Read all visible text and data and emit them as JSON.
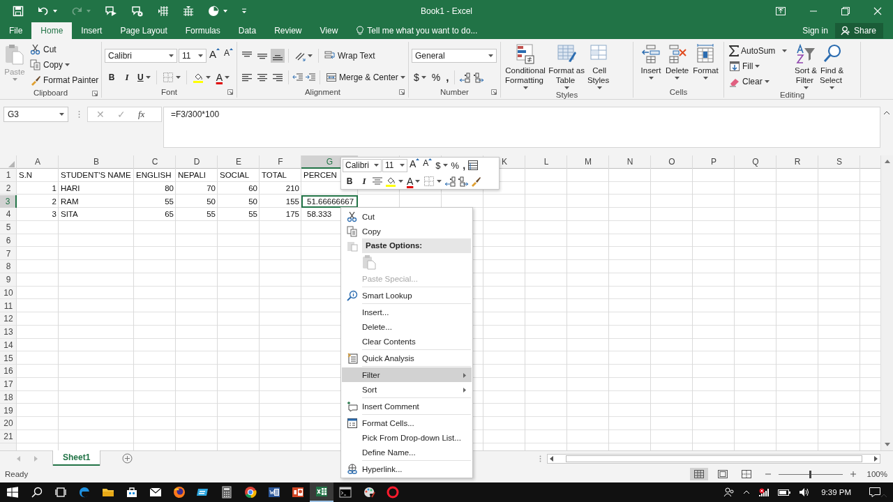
{
  "window": {
    "title": "Book1 - Excel"
  },
  "ribbon_tabs": [
    {
      "label": "File",
      "selected": false
    },
    {
      "label": "Home",
      "selected": true
    },
    {
      "label": "Insert",
      "selected": false
    },
    {
      "label": "Page Layout",
      "selected": false
    },
    {
      "label": "Formulas",
      "selected": false
    },
    {
      "label": "Data",
      "selected": false
    },
    {
      "label": "Review",
      "selected": false
    },
    {
      "label": "View",
      "selected": false
    }
  ],
  "tell_me": {
    "placeholder": "Tell me what you want to do..."
  },
  "account": {
    "sign_in": "Sign in",
    "share": "Share"
  },
  "ribbon": {
    "clipboard": {
      "label": "Clipboard",
      "paste": "Paste",
      "cut": "Cut",
      "copy": "Copy",
      "format_painter": "Format Painter"
    },
    "font": {
      "label": "Font",
      "font_name": "Calibri",
      "font_size": "11",
      "grow": "A",
      "shrink": "A",
      "bold": "B",
      "italic": "I",
      "underline": "U",
      "font_color": "A"
    },
    "alignment": {
      "label": "Alignment",
      "vertical_align": [
        {
          "selected": false
        },
        {
          "selected": false
        },
        {
          "selected": true
        }
      ],
      "wrap_text": "Wrap Text",
      "merge_center": "Merge & Center"
    },
    "number": {
      "label": "Number",
      "format": "General",
      "currency": "$",
      "percent": "%",
      "comma": ","
    },
    "styles": {
      "label": "Styles",
      "buttons": [
        "Conditional\nFormatting",
        "Format as\nTable",
        "Cell\nStyles"
      ]
    },
    "cells": {
      "label": "Cells",
      "buttons": [
        "Insert",
        "Delete",
        "Format"
      ]
    },
    "editing": {
      "label": "Editing",
      "autosum": "AutoSum",
      "fill": "Fill",
      "clear": "Clear",
      "sort_filter": "Sort &\nFilter",
      "find_select": "Find &\nSelect"
    }
  },
  "formula_bar": {
    "name_box": "G3",
    "cancel": "✕",
    "enter": "✓",
    "function": "fx",
    "formula": "=F3/300*100"
  },
  "sheet": {
    "columns": [
      {
        "label": "A",
        "selected": false,
        "kind": "number"
      },
      {
        "label": "B",
        "selected": false,
        "kind": "text"
      },
      {
        "label": "C",
        "selected": false,
        "kind": "number"
      },
      {
        "label": "D",
        "selected": false,
        "kind": "number"
      },
      {
        "label": "E",
        "selected": false,
        "kind": "number"
      },
      {
        "label": "F",
        "selected": false,
        "kind": "number"
      },
      {
        "label": "G",
        "selected": true,
        "kind": "decimal"
      },
      {
        "selected": false
      },
      {
        "selected": false
      },
      {
        "selected": false
      },
      {
        "label": "K",
        "selected": false
      },
      {
        "label": "L",
        "selected": false
      },
      {
        "label": "M",
        "selected": false
      },
      {
        "label": "N",
        "selected": false
      },
      {
        "label": "O",
        "selected": false
      },
      {
        "label": "P",
        "selected": false
      },
      {
        "label": "Q",
        "selected": false
      },
      {
        "label": "R",
        "selected": false
      },
      {
        "label": "S",
        "selected": false
      }
    ],
    "rows": [
      {
        "label": "1",
        "selected": false,
        "kind": "header",
        "cells": [
          "S.N",
          "STUDENT'S NAME",
          "ENGLISH",
          "NEPALI",
          "SOCIAL",
          "TOTAL",
          "PERCEN"
        ]
      },
      {
        "label": "2",
        "selected": false,
        "kind": "data",
        "cells": [
          "1",
          "HARI",
          "80",
          "70",
          "60",
          "210"
        ]
      },
      {
        "label": "3",
        "selected": true,
        "kind": "data",
        "cells": [
          "2",
          "RAM",
          "55",
          "50",
          "50",
          "155",
          "51.66666667"
        ]
      },
      {
        "label": "4",
        "selected": false,
        "kind": "data",
        "cells": [
          "3",
          "SITA",
          "65",
          "55",
          "55",
          "175",
          "58.333"
        ]
      },
      {
        "label": "5",
        "selected": false
      },
      {
        "label": "6",
        "selected": false
      },
      {
        "label": "7",
        "selected": false
      },
      {
        "label": "8",
        "selected": false
      },
      {
        "label": "9",
        "selected": false
      },
      {
        "label": "10",
        "selected": false
      },
      {
        "label": "11",
        "selected": false
      },
      {
        "label": "12",
        "selected": false
      },
      {
        "label": "13",
        "selected": false
      },
      {
        "label": "14",
        "selected": false
      },
      {
        "label": "15",
        "selected": false
      },
      {
        "label": "16",
        "selected": false
      },
      {
        "label": "17",
        "selected": false
      },
      {
        "label": "18",
        "selected": false
      },
      {
        "label": "19",
        "selected": false
      },
      {
        "label": "20",
        "selected": false
      },
      {
        "label": "21",
        "selected": false
      }
    ]
  },
  "sheet_tabs": [
    {
      "label": "Sheet1",
      "selected": true
    }
  ],
  "status_bar": {
    "status": "Ready",
    "views": [
      {
        "selected": true
      },
      {
        "selected": false
      },
      {
        "selected": false
      }
    ],
    "zoom_slider": {
      "level": 0.5
    },
    "zoom": "100%"
  },
  "mini_toolbar": {
    "font_name": "Calibri",
    "font_size": "11",
    "grow": "A",
    "shrink": "A",
    "currency": "$",
    "percent": "%",
    "comma": ",",
    "bold": "B",
    "italic": "I",
    "font_color": "A"
  },
  "context_menu": [
    {
      "kind": "item",
      "label": "Cut",
      "selected": false,
      "disabled": false
    },
    {
      "kind": "item",
      "label": "Copy",
      "selected": false,
      "disabled": false
    },
    {
      "kind": "header",
      "label": "Paste Options:"
    },
    {
      "kind": "paste_icons"
    },
    {
      "kind": "item",
      "label": "Paste Special...",
      "selected": false,
      "disabled": true
    },
    {
      "kind": "separator"
    },
    {
      "kind": "item",
      "label": "Smart Lookup",
      "selected": false,
      "disabled": false
    },
    {
      "kind": "separator"
    },
    {
      "kind": "item",
      "label": "Insert...",
      "selected": false,
      "disabled": false
    },
    {
      "kind": "item",
      "label": "Delete...",
      "selected": false,
      "disabled": false
    },
    {
      "kind": "item",
      "label": "Clear Contents",
      "selected": false,
      "disabled": false
    },
    {
      "kind": "separator"
    },
    {
      "kind": "item",
      "label": "Quick Analysis",
      "selected": false,
      "disabled": false
    },
    {
      "kind": "separator"
    },
    {
      "kind": "submenu",
      "label": "Filter",
      "selected": true,
      "disabled": false
    },
    {
      "kind": "submenu",
      "label": "Sort",
      "selected": false,
      "disabled": false
    },
    {
      "kind": "separator"
    },
    {
      "kind": "item",
      "label": "Insert Comment",
      "selected": false,
      "disabled": false
    },
    {
      "kind": "separator"
    },
    {
      "kind": "item",
      "label": "Format Cells...",
      "selected": false,
      "disabled": false
    },
    {
      "kind": "item",
      "label": "Pick From Drop-down List...",
      "selected": false,
      "disabled": false
    },
    {
      "kind": "item",
      "label": "Define Name...",
      "selected": false,
      "disabled": false
    },
    {
      "kind": "separator"
    },
    {
      "kind": "item",
      "label": "Hyperlink...",
      "selected": false,
      "disabled": false
    }
  ],
  "taskbar": {
    "apps": [
      {
        "active": false
      },
      {
        "active": false
      },
      {
        "active": false
      },
      {
        "active": false
      },
      {
        "active": false
      },
      {
        "active": false
      },
      {
        "active": false
      },
      {
        "active": false
      },
      {
        "active": false
      },
      {
        "active": false
      },
      {
        "active": true
      },
      {
        "active": false
      },
      {
        "active": false
      },
      {
        "active": false
      }
    ],
    "time": "9:39 PM"
  }
}
